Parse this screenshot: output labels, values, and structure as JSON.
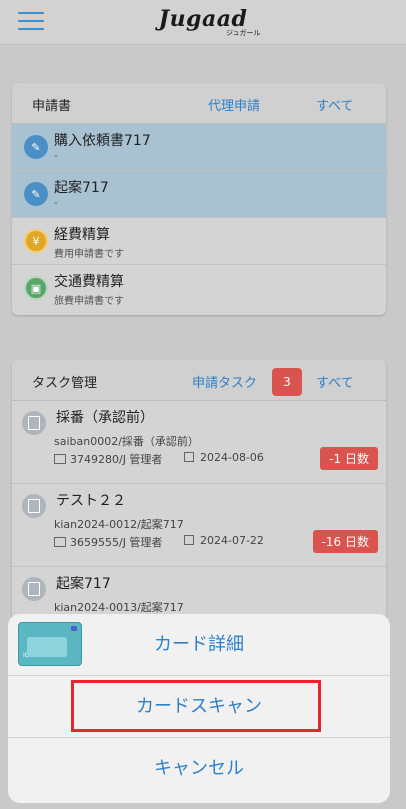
{
  "header": {
    "logo": "Jugaad",
    "logo_sub": "ジュガール"
  },
  "applications": {
    "title": "申請書",
    "proxy_link": "代理申請",
    "all_link": "すべて",
    "items": [
      {
        "title": "購入依頼書717",
        "subtitle": "-",
        "icon": "pin-icon",
        "pinned": true
      },
      {
        "title": "起案717",
        "subtitle": "-",
        "icon": "pin-icon",
        "pinned": true
      },
      {
        "title": "経費精算",
        "subtitle": "費用申請書です",
        "icon": "yen-icon",
        "pinned": false
      },
      {
        "title": "交通費精算",
        "subtitle": "旅費申請書です",
        "icon": "train-icon",
        "pinned": false
      }
    ]
  },
  "tasks": {
    "title": "タスク管理",
    "request_link": "申請タスク",
    "count": "3",
    "all_link": "すべて",
    "items": [
      {
        "title": "採番（承認前）",
        "subtitle": "saiban0002/採番（承認前）",
        "user": "3749280/J 管理者",
        "date": "2024-08-06",
        "days": "-1 日数"
      },
      {
        "title": "テスト２２",
        "subtitle": "kian2024-0012/起案717",
        "user": "3659555/J 管理者",
        "date": "2024-07-22",
        "days": "-16 日数"
      },
      {
        "title": "起案717",
        "subtitle": "kian2024-0013/起案717"
      }
    ]
  },
  "sheet": {
    "card_label": "IC カード",
    "card_detail": "カード詳細",
    "card_scan": "カードスキャン",
    "cancel": "キャンセル"
  },
  "colors": {
    "accent": "#2f80c8",
    "badge": "#d9534f",
    "highlight": "#e6262d",
    "pinned": "#a9c2d2"
  }
}
